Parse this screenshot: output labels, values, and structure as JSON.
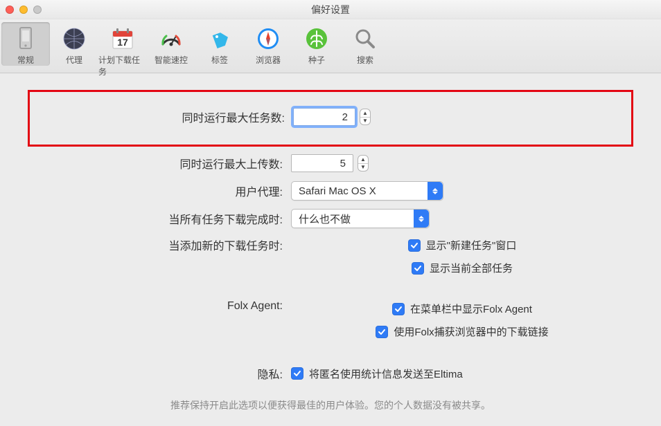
{
  "window": {
    "title": "偏好设置"
  },
  "toolbar": {
    "items": [
      {
        "id": "general",
        "label": "常规"
      },
      {
        "id": "proxy",
        "label": "代理"
      },
      {
        "id": "schedule",
        "label": "计划下载任务"
      },
      {
        "id": "smart",
        "label": "智能速控"
      },
      {
        "id": "tags",
        "label": "标签"
      },
      {
        "id": "browser",
        "label": "浏览器"
      },
      {
        "id": "seeds",
        "label": "种子"
      },
      {
        "id": "search",
        "label": "搜索"
      }
    ]
  },
  "fields": {
    "maxTasksLabel": "同时运行最大任务数:",
    "maxTasksValue": "2",
    "maxUploadsLabel": "同时运行最大上传数:",
    "maxUploadsValue": "5",
    "userAgentLabel": "用户代理:",
    "userAgentValue": "Safari Mac OS X",
    "onCompleteLabel": "当所有任务下载完成时:",
    "onCompleteValue": "什么也不做",
    "newTaskLabel": "当添加新的下载任务时:",
    "newTaskOpt1": "显示\"新建任务\"窗口",
    "newTaskOpt2": "显示当前全部任务",
    "agentLabel": "Folx Agent:",
    "agentOpt1": "在菜单栏中显示Folx Agent",
    "agentOpt2": "使用Folx捕获浏览器中的下载链接",
    "privacyLabel": "隐私:",
    "privacyOpt": "将匿名使用统计信息发送至Eltima"
  },
  "footnote": "推荐保持开启此选项以便获得最佳的用户体验。您的个人数据没有被共享。"
}
